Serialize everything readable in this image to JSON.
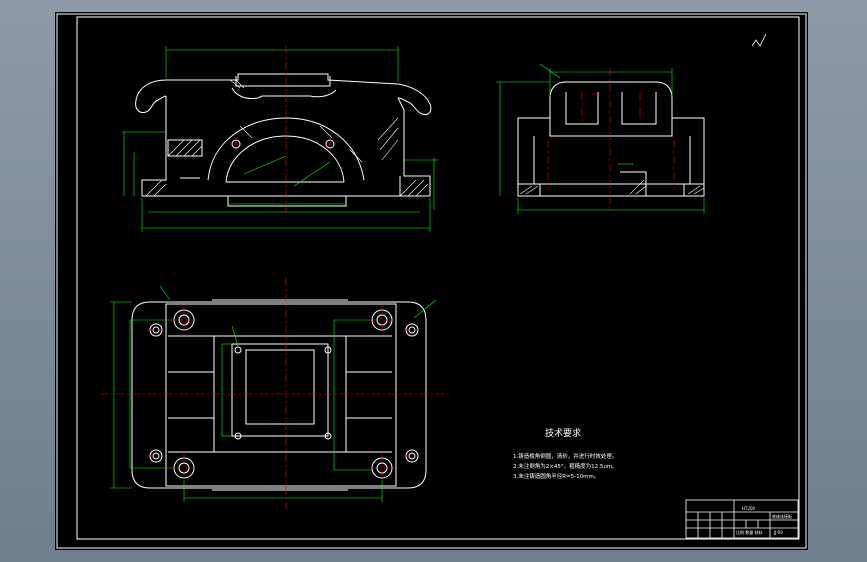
{
  "tech_requirements": {
    "title": "技术要求",
    "items": [
      "1.铸造棱角倒圆，清砂，并进行时效处理。",
      "2.未注倒角为2×45°，粗糙度为12.5um。",
      "3.未注铸造圆角半径R=5-10mm。"
    ]
  },
  "title_block": {
    "material": "HT200",
    "part_name": "底座连接板",
    "drawing_no": "JJ-09",
    "scale_row": "比例  数量  材料"
  },
  "colors": {
    "paper": "#000000",
    "frame": "#ffffff",
    "geometry": "#ffffff",
    "dimension": "#00ff00",
    "centerline": "#ff0000",
    "hatch": "#ffffff",
    "background": "#7f8c9c"
  }
}
